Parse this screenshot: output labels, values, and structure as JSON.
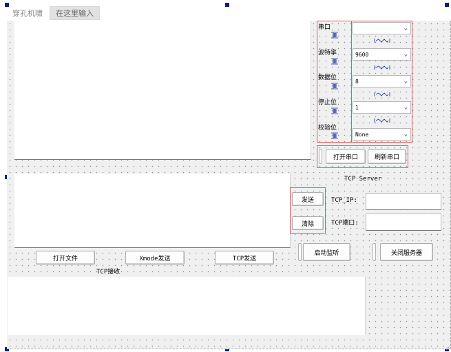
{
  "menubar": {
    "title": "穿孔机啸",
    "input_placeholder": "在这里输入"
  },
  "serial": {
    "labels": {
      "port": "串口",
      "baud": "波特率",
      "databits": "数据位",
      "stopbits": "停止位",
      "parity": "校验位"
    },
    "values": {
      "port": "",
      "baud": "9600",
      "databits": "8",
      "stopbits": "1",
      "parity": "None"
    },
    "buttons": {
      "open_port": "打开串口",
      "refresh_port": "刷新串口"
    }
  },
  "send": {
    "send_button": "发送",
    "clear_button": "清除"
  },
  "tcp_server": {
    "title": "TCP Server",
    "ip_label": "TCP_IP:",
    "port_label": "TCP端口:",
    "ip_value": "",
    "port_value": "",
    "start_button": "启动监听",
    "close_button": "关闭服务器"
  },
  "bottom_buttons": {
    "open_file": "打开文件",
    "xmode_send": "Xmode发送",
    "tcp_send": "TCP发送"
  },
  "tcp_receive": {
    "label": "TCP接收"
  },
  "colors": {
    "selection_handle": "#0d1f7a",
    "layout_box": "#e05a5a",
    "form_background": "#f0f0f0"
  }
}
